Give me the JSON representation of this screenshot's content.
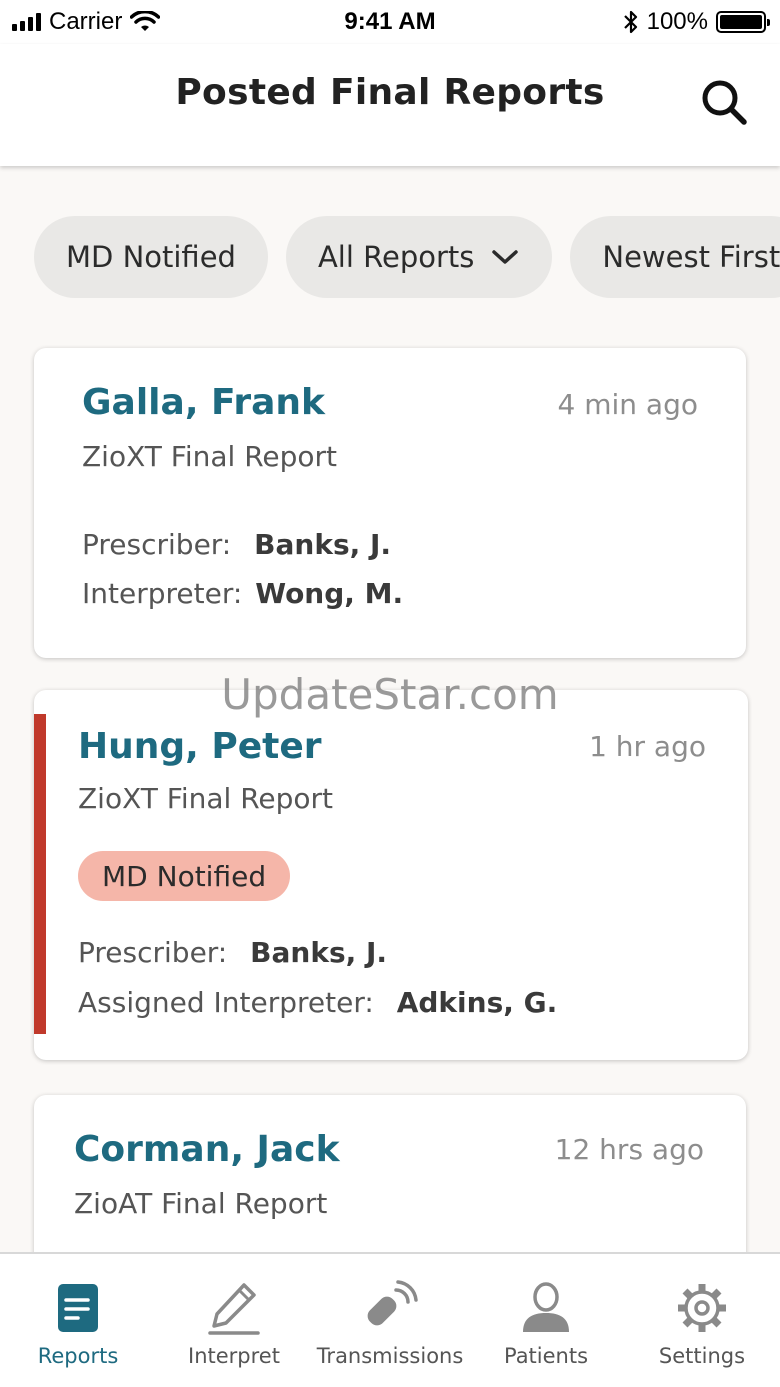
{
  "status_bar": {
    "carrier": "Carrier",
    "time": "9:41 AM",
    "battery": "100%"
  },
  "header": {
    "title": "Posted Final Reports",
    "search_icon": "search-icon"
  },
  "filters": [
    {
      "label": "MD Notified"
    },
    {
      "label": "All Reports",
      "icon": "chevron-down-icon"
    },
    {
      "label": "Newest First"
    }
  ],
  "reports": [
    {
      "name": "Galla, Frank",
      "time": "4 min ago",
      "type": "ZioXT Final Report",
      "prescriber_label": "Prescriber:",
      "prescriber": "Banks, J.",
      "interpreter_label": "Interpreter:",
      "interpreter": "Wong, M."
    },
    {
      "name": "Hung, Peter",
      "time": "1 hr ago",
      "type": "ZioXT Final Report",
      "badge": "MD Notified",
      "prescriber_label": "Prescriber:",
      "prescriber": "Banks, J.",
      "interpreter_label": "Assigned Interpreter:",
      "interpreter": "Adkins, G."
    },
    {
      "name": "Corman, Jack",
      "time": "12 hrs ago",
      "type": "ZioAT Final Report"
    }
  ],
  "watermark": "UpdateStar.com",
  "tabs": [
    {
      "label": "Reports",
      "icon": "report-document-icon",
      "active": true
    },
    {
      "label": "Interpret",
      "icon": "pencil-icon"
    },
    {
      "label": "Transmissions",
      "icon": "transmission-device-icon"
    },
    {
      "label": "Patients",
      "icon": "person-icon"
    },
    {
      "label": "Settings",
      "icon": "gear-icon"
    }
  ],
  "colors": {
    "accent": "#1e6a80",
    "alert": "#c0392b",
    "badge_bg": "#f5b6a9",
    "pill_bg": "#e9e8e6"
  }
}
